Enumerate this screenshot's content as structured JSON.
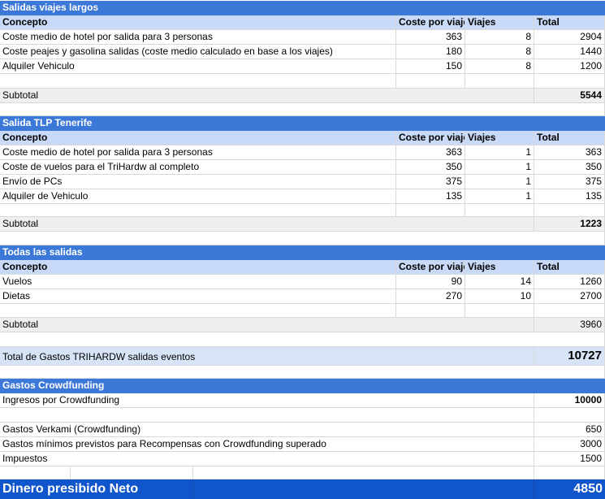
{
  "section1": {
    "title": "Salidas viajes largos",
    "headers": [
      "Concepto",
      "Coste por viaje",
      "Viajes",
      "Total"
    ],
    "rows": [
      [
        "Coste medio de hotel por salida para 3 personas",
        "363",
        "8",
        "2904"
      ],
      [
        "Coste peajes y gasolina salidas (coste medio calculado en base a los viajes)",
        "180",
        "8",
        "1440"
      ],
      [
        "Alquiler Vehiculo",
        "150",
        "8",
        "1200"
      ]
    ],
    "subtotal_label": "Subtotal",
    "subtotal_value": "5544"
  },
  "section2": {
    "title": "Salida TLP Tenerife",
    "headers": [
      "Concepto",
      "Coste por viaje",
      "Viajes",
      "Total"
    ],
    "rows": [
      [
        "Coste medio de hotel por salida para 3 personas",
        "363",
        "1",
        "363"
      ],
      [
        "Coste de vuelos para el TriHardw al completo",
        "350",
        "1",
        "350"
      ],
      [
        "Envío de PCs",
        "375",
        "1",
        "375"
      ],
      [
        "Alquiler de Vehiculo",
        "135",
        "1",
        "135"
      ]
    ],
    "subtotal_label": "Subtotal",
    "subtotal_value": "1223"
  },
  "section3": {
    "title": "Todas las salidas",
    "headers": [
      "Concepto",
      "Coste por viaje",
      "Viajes",
      "Total"
    ],
    "rows": [
      [
        "Vuelos",
        "90",
        "14",
        "1260"
      ],
      [
        "Dietas",
        "270",
        "10",
        "2700"
      ]
    ],
    "subtotal_label": "Subtotal",
    "subtotal_value": "3960"
  },
  "total_gastos": {
    "label": "Total de Gastos TRIHARDW salidas eventos",
    "value": "10727"
  },
  "crowdfunding": {
    "title": "Gastos Crowdfunding",
    "ingresos_label": "Ingresos por Crowdfunding",
    "ingresos_value": "10000",
    "rows": [
      [
        "Gastos Verkami (Crowdfunding)",
        "650"
      ],
      [
        "Gastos mínimos previstos para Recompensas con Crowdfunding superado",
        "3000"
      ],
      [
        "Impuestos",
        "1500"
      ]
    ]
  },
  "final": {
    "label": "Dinero presibido Neto",
    "value": "4850"
  },
  "colors": {
    "section_header": "#3c78d8",
    "column_header": "#c9daf8",
    "final_row": "#1155cc"
  }
}
